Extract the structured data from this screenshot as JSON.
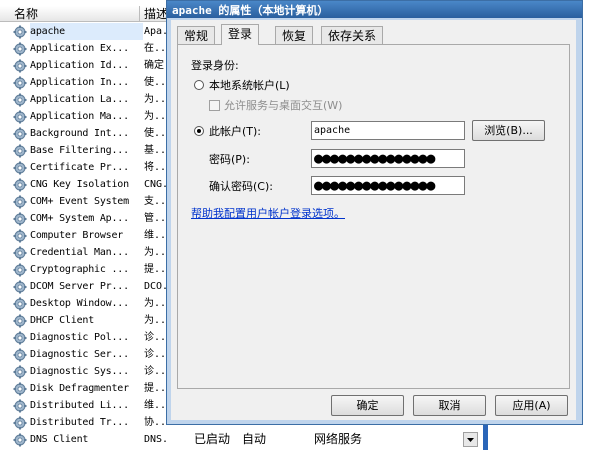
{
  "services": {
    "columns": {
      "name": "名称",
      "description": "描述"
    },
    "rows": [
      {
        "name": "apache",
        "desc": "Apa."
      },
      {
        "name": "Application Ex...",
        "desc": "在.."
      },
      {
        "name": "Application Id...",
        "desc": "确定"
      },
      {
        "name": "Application In...",
        "desc": "使.."
      },
      {
        "name": "Application La...",
        "desc": "为.."
      },
      {
        "name": "Application Ma...",
        "desc": "为.."
      },
      {
        "name": "Background Int...",
        "desc": "使.."
      },
      {
        "name": "Base Filtering...",
        "desc": "基.."
      },
      {
        "name": "Certificate Pr...",
        "desc": "将.."
      },
      {
        "name": "CNG Key Isolation",
        "desc": "CNG."
      },
      {
        "name": "COM+ Event System",
        "desc": "支.."
      },
      {
        "name": "COM+ System Ap...",
        "desc": "管.."
      },
      {
        "name": "Computer Browser",
        "desc": "维.."
      },
      {
        "name": "Credential Man...",
        "desc": "为.."
      },
      {
        "name": "Cryptographic ...",
        "desc": "提.."
      },
      {
        "name": "DCOM Server Pr...",
        "desc": "DCO."
      },
      {
        "name": "Desktop Window...",
        "desc": "为.."
      },
      {
        "name": "DHCP Client",
        "desc": "为.."
      },
      {
        "name": "Diagnostic Pol...",
        "desc": "诊.."
      },
      {
        "name": "Diagnostic Ser...",
        "desc": "诊.."
      },
      {
        "name": "Diagnostic Sys...",
        "desc": "诊.."
      },
      {
        "name": "Disk Defragmenter",
        "desc": "提.."
      },
      {
        "name": "Distributed Li...",
        "desc": "维.."
      },
      {
        "name": "Distributed Tr...",
        "desc": "协.."
      },
      {
        "name": "DNS Client",
        "desc": "DNS."
      }
    ],
    "last_row_status": "已启动",
    "last_row_startup": "自动",
    "last_row_logon": "网络服务"
  },
  "dialog": {
    "title": "apache 的属性（本地计算机）",
    "tabs": [
      "常规",
      "登录",
      "恢复",
      "依存关系"
    ],
    "active_tab": 1,
    "logon_as_label": "登录身份:",
    "local_system_label": "本地系统帐户(L)",
    "allow_desktop_label": "允许服务与桌面交互(W)",
    "this_account_label": "此帐户(T):",
    "account_value": "apache",
    "browse_label": "浏览(B)...",
    "password_label": "密码(P):",
    "password_value": "●●●●●●●●●●●●●●●",
    "confirm_label": "确认密码(C):",
    "confirm_value": "●●●●●●●●●●●●●●●",
    "help_link": "帮助我配置用户帐户登录选项。",
    "ok_label": "确定",
    "cancel_label": "取消",
    "apply_label": "应用(A)"
  }
}
